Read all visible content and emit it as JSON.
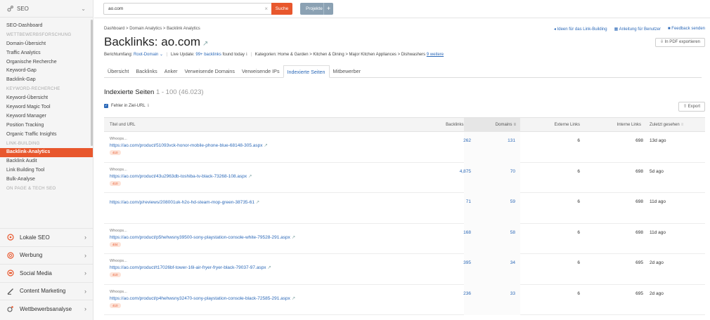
{
  "sidebar": {
    "top_label": "SEO",
    "items": [
      {
        "type": "item",
        "label": "SEO-Dashboard"
      },
      {
        "type": "section",
        "label": "WETTBEWERBSFORSCHUNG"
      },
      {
        "type": "item",
        "label": "Domain-Übersicht"
      },
      {
        "type": "item",
        "label": "Traffic Analytics"
      },
      {
        "type": "item",
        "label": "Organische Recherche"
      },
      {
        "type": "item",
        "label": "Keyword-Gap"
      },
      {
        "type": "item",
        "label": "Backlink-Gap"
      },
      {
        "type": "section",
        "label": "KEYWORD-RECHERCHE"
      },
      {
        "type": "item",
        "label": "Keyword-Übersicht"
      },
      {
        "type": "item",
        "label": "Keyword Magic Tool"
      },
      {
        "type": "item",
        "label": "Keyword Manager"
      },
      {
        "type": "item",
        "label": "Position Tracking"
      },
      {
        "type": "item",
        "label": "Organic Traffic Insights"
      },
      {
        "type": "section",
        "label": "LINK-BUILDING"
      },
      {
        "type": "item",
        "label": "Backlink-Analytics",
        "active": true
      },
      {
        "type": "item",
        "label": "Backlink Audit"
      },
      {
        "type": "item",
        "label": "Link Building Tool"
      },
      {
        "type": "item",
        "label": "Bulk-Analyse"
      },
      {
        "type": "section",
        "label": "ON PAGE & TECH SEO"
      }
    ],
    "groups": [
      {
        "label": "Lokale SEO",
        "icon": "location-pin-icon"
      },
      {
        "label": "Werbung",
        "icon": "target-icon"
      },
      {
        "label": "Social Media",
        "icon": "chat-bubble-icon"
      },
      {
        "label": "Content Marketing",
        "icon": "pencil-icon"
      },
      {
        "label": "Wettbewerbsanalyse",
        "icon": "competitor-icon"
      }
    ]
  },
  "topbar": {
    "search_value": "ao.com",
    "search_button": "Suche",
    "projects_button": "Projekte",
    "projects_plus": "+"
  },
  "header": {
    "breadcrumb": [
      "Dashboard",
      "Domain Analytics",
      "Backlink Analytics"
    ],
    "links": [
      "Ideen für das Link-Building",
      "Anleitung für Benutzer",
      "Feedback senden"
    ],
    "title": "Backlinks: ao.com",
    "pdf_button": "In PDF exportieren",
    "meta": {
      "scope_label": "Berichtumfang:",
      "scope_value": "Root-Domain",
      "live_label": "Live Update:",
      "live_value": "99+ backlinks",
      "live_suffix": "found today",
      "cat_label": "Kategorien:",
      "cat_value": "Home & Garden > Kitchen & Dining > Major Kitchen Appliances > Dishwashers",
      "more": "9 weitere"
    }
  },
  "tabs": [
    {
      "label": "Übersicht"
    },
    {
      "label": "Backlinks"
    },
    {
      "label": "Anker"
    },
    {
      "label": "Verweisende Domains"
    },
    {
      "label": "Verweisende IPs"
    },
    {
      "label": "Indexierte Seiten",
      "active": true
    },
    {
      "label": "Mitbewerber"
    }
  ],
  "section": {
    "title": "Indexierte Seiten",
    "count": "1 - 100 (46.023)",
    "checkbox_label": "Fehler in Ziel-URL",
    "export": "Export"
  },
  "table": {
    "headers": {
      "title": "Titel und URL",
      "backlinks": "Backlinks",
      "domains": "Domains",
      "external": "Externe Links",
      "internal": "Interne Links",
      "last_seen": "Zuletzt gesehen"
    },
    "rows": [
      {
        "title": "Whoops...",
        "url": "https://ao.com/product/51093vck-honor-mobile-phone-blue-68148-305.aspx",
        "badge": "410",
        "backlinks": "262",
        "domains": "131",
        "external": "6",
        "internal": "698",
        "seen": "13d ago"
      },
      {
        "title": "Whoops...",
        "url": "https://ao.com/product/43u2963db-toshiba-tv-black-73268-108.aspx",
        "badge": "410",
        "backlinks": "4,875",
        "domains": "70",
        "external": "6",
        "internal": "698",
        "seen": "5d ago"
      },
      {
        "title": "",
        "url": "https://ao.com/p/reviews/208001uk-h2o-hd-steam-mop-green-38735-61",
        "badge": "",
        "backlinks": "71",
        "domains": "59",
        "external": "6",
        "internal": "698",
        "seen": "11d ago"
      },
      {
        "title": "Whoops...",
        "url": "https://ao.com/product/p5hehwsny39500-sony-playstation-console-white-79528-291.aspx",
        "badge": "404",
        "backlinks": "168",
        "domains": "58",
        "external": "6",
        "internal": "698",
        "seen": "11d ago"
      },
      {
        "title": "Whoops...",
        "url": "https://ao.com/product/t17026bf-tower-16l-air-fryer-fryer-black-79037-97.aspx",
        "badge": "410",
        "backlinks": "395",
        "domains": "34",
        "external": "6",
        "internal": "695",
        "seen": "2d ago"
      },
      {
        "title": "Whoops...",
        "url": "https://ao.com/product/p4hehwsny32470-sony-playstation-console-black-72585-291.aspx",
        "badge": "410",
        "backlinks": "236",
        "domains": "33",
        "external": "6",
        "internal": "695",
        "seen": "2d ago"
      }
    ]
  },
  "colors": {
    "accent": "#e8572d",
    "link": "#2c69b8"
  }
}
